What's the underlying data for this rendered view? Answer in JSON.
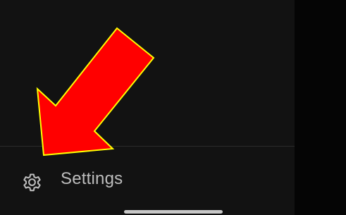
{
  "drawer": {
    "settings_label": "Settings",
    "settings_icon": "gear-icon"
  },
  "annotation": {
    "arrow_icon": "red-arrow-icon",
    "arrow_fill": "#ff0000",
    "arrow_outline": "#ffff00"
  },
  "colors": {
    "drawer_background": "#121212",
    "label_color": "#bdbdbd"
  }
}
